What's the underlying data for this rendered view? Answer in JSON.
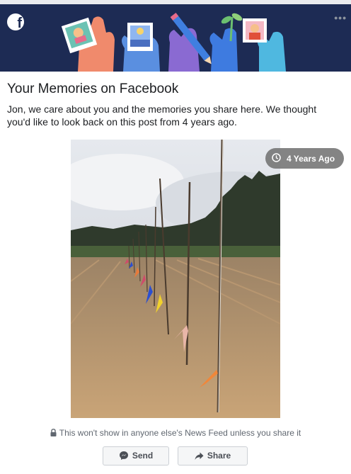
{
  "banner": {
    "logo_glyph": "f",
    "more_glyph": "•••",
    "bg_color": "#1d2b54"
  },
  "card": {
    "title": "Your Memories on Facebook",
    "message": "Jon, we care about you and the memories you share here. We thought you'd like to look back on this post from 4 years ago.",
    "badge": "4 Years Ago",
    "photo_alt": "Young tree saplings planted in a row in a dirt field",
    "privacy_note": "This won't show in anyone else's News Feed unless you share it"
  },
  "actions": {
    "send_label": "Send",
    "share_label": "Share"
  },
  "icons": {
    "logo": "facebook-logo-icon",
    "more": "more-options-icon",
    "clock": "clock-icon",
    "lock": "lock-icon",
    "messenger": "messenger-icon",
    "share": "share-arrow-icon"
  }
}
